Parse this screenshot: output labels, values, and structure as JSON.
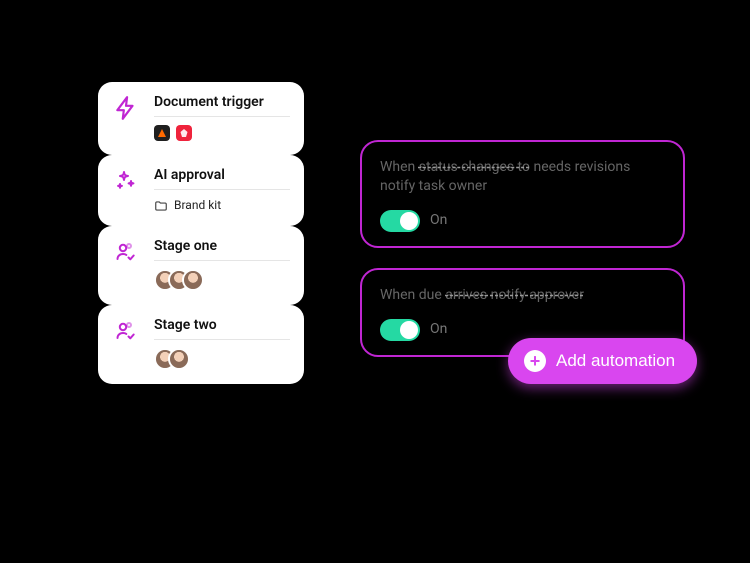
{
  "stages": [
    {
      "title": "Document trigger",
      "icon": "lightning"
    },
    {
      "title": "AI approval",
      "icon": "sparkle",
      "subtext": "Brand kit"
    },
    {
      "title": "Stage one",
      "icon": "person-check"
    },
    {
      "title": "Stage two",
      "icon": "person-check"
    }
  ],
  "automations": [
    {
      "text_a": "When ",
      "strike_a": "status changes to",
      "text_b": " needs revisions notify task owner",
      "toggle": "On"
    },
    {
      "text_a": "When due ",
      "strike_a": "arrives notify approver",
      "text_b": "",
      "toggle": "On"
    }
  ],
  "add_button": "Add automation",
  "colors": {
    "accent": "#c026d3",
    "toggle_on": "#25d9a3",
    "button": "#d946ef"
  }
}
